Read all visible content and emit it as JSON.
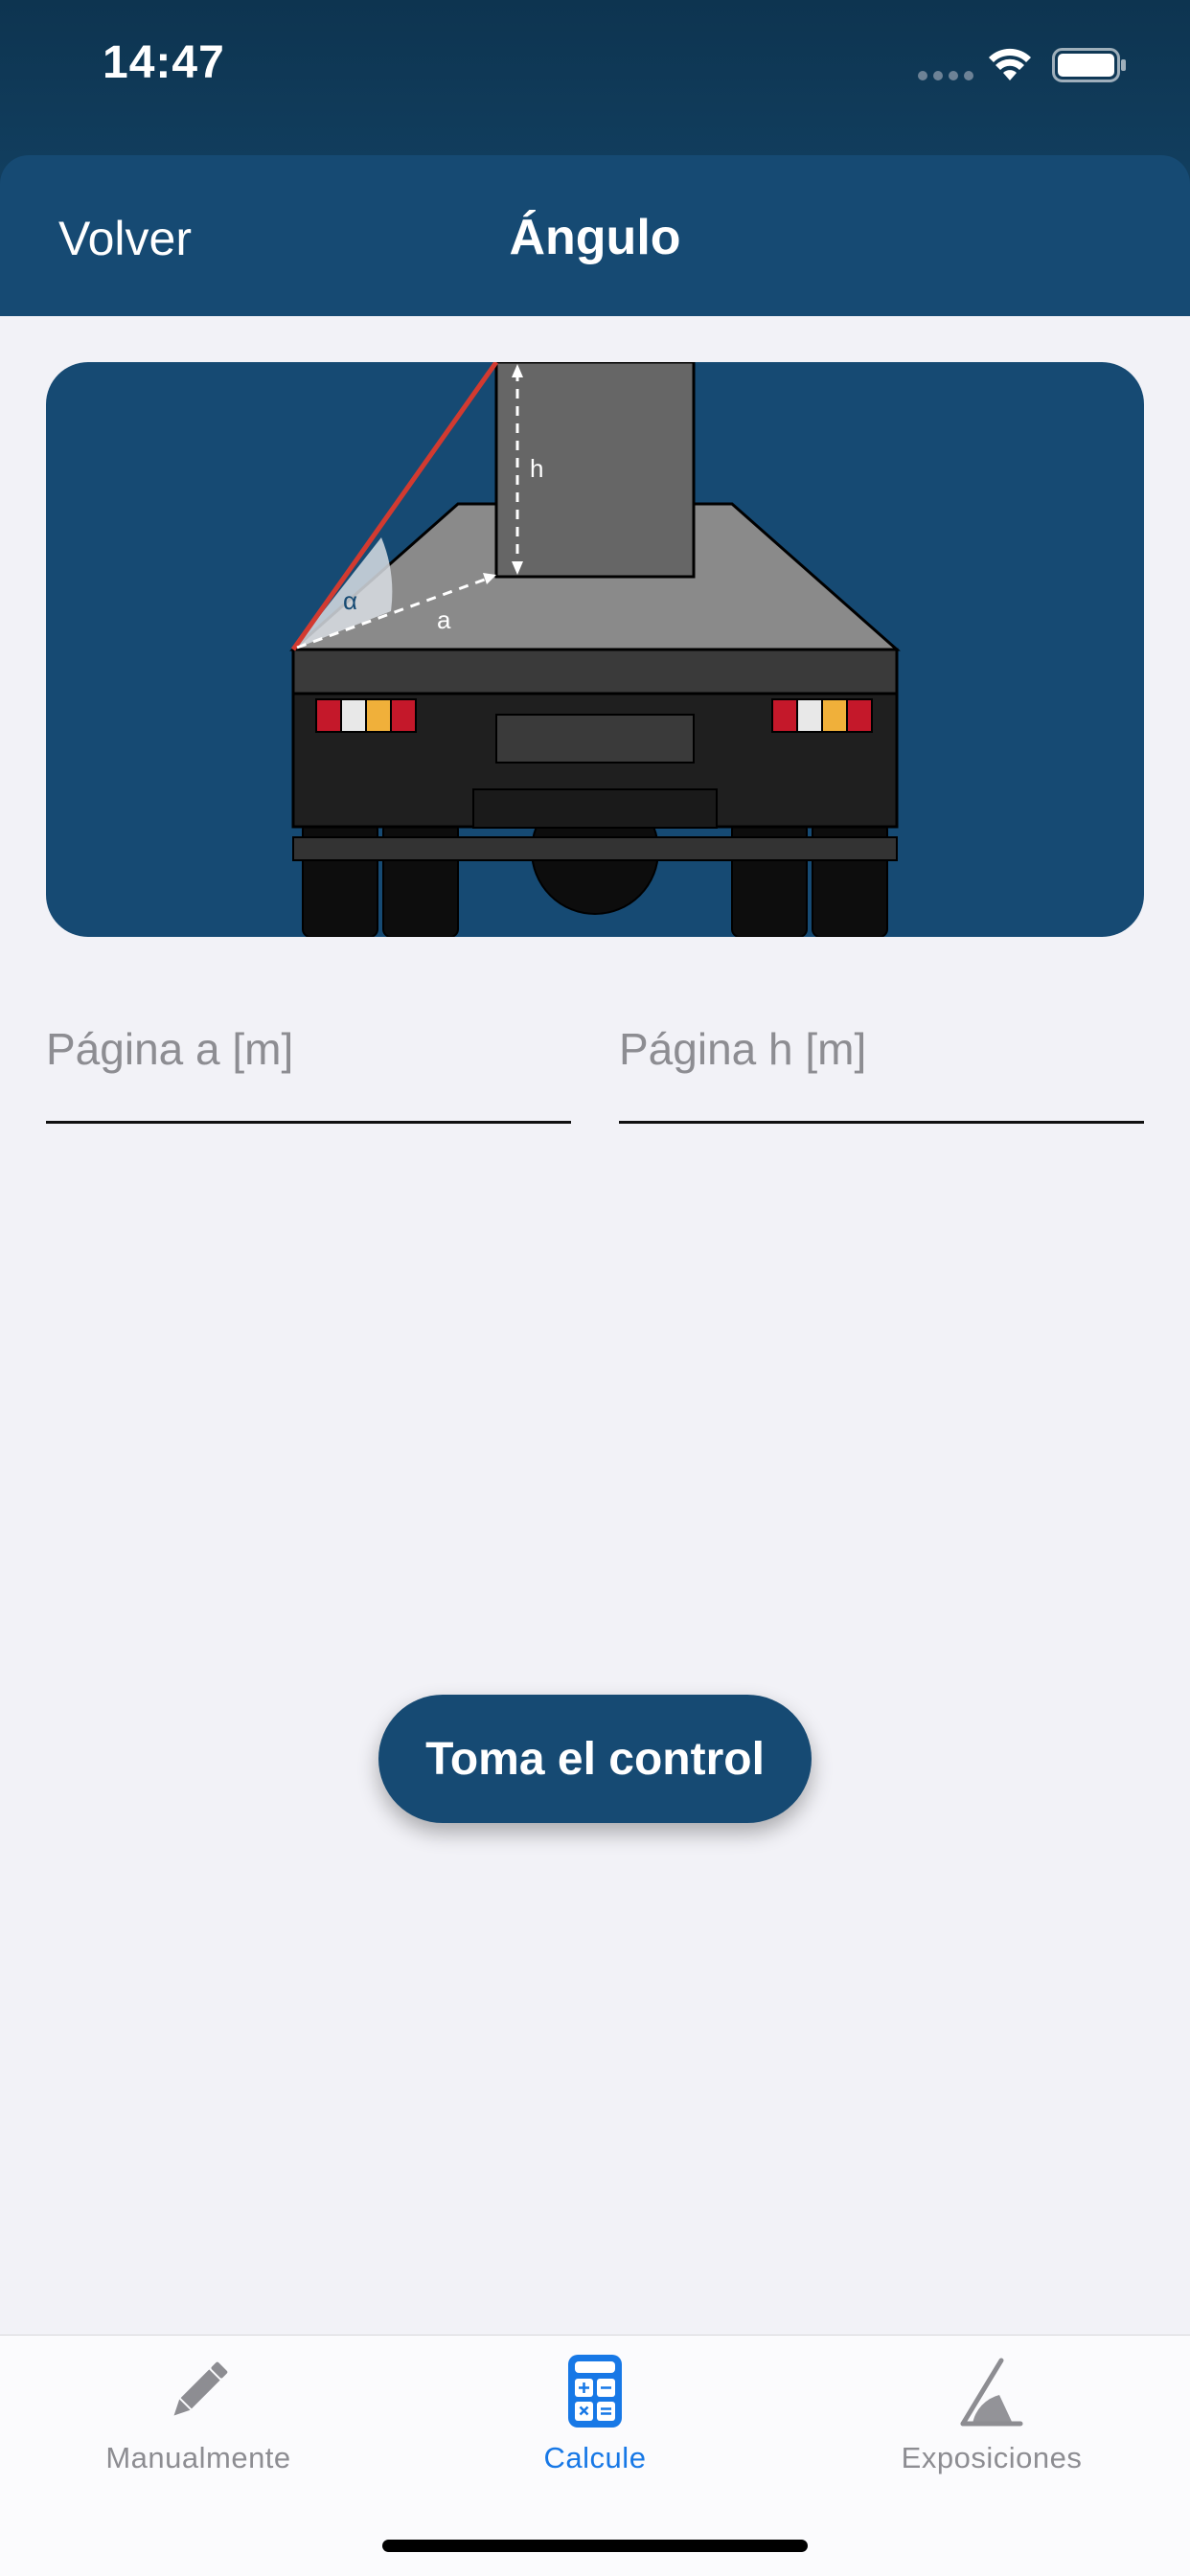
{
  "status_bar": {
    "time": "14:47"
  },
  "nav": {
    "back_label": "Volver",
    "title": "Ángulo"
  },
  "illustration": {
    "description_icon": "truck-angle-diagram-icon",
    "label_alpha": "α",
    "label_a": "a",
    "label_h": "h",
    "colors": {
      "background": "#164a73",
      "angle_line": "#d23a30"
    }
  },
  "form": {
    "field_a_placeholder": "Página a [m]",
    "field_a_value": "",
    "field_h_placeholder": "Página h [m]",
    "field_h_value": ""
  },
  "cta": {
    "label": "Toma el control"
  },
  "tabs": [
    {
      "label": "Manualmente",
      "icon": "pencil-icon",
      "active": false
    },
    {
      "label": "Calcule",
      "icon": "calculator-icon",
      "active": true
    },
    {
      "label": "Exposiciones",
      "icon": "angle-icon",
      "active": false
    }
  ],
  "colors": {
    "accent": "#1778e6",
    "brand": "#164a73"
  }
}
